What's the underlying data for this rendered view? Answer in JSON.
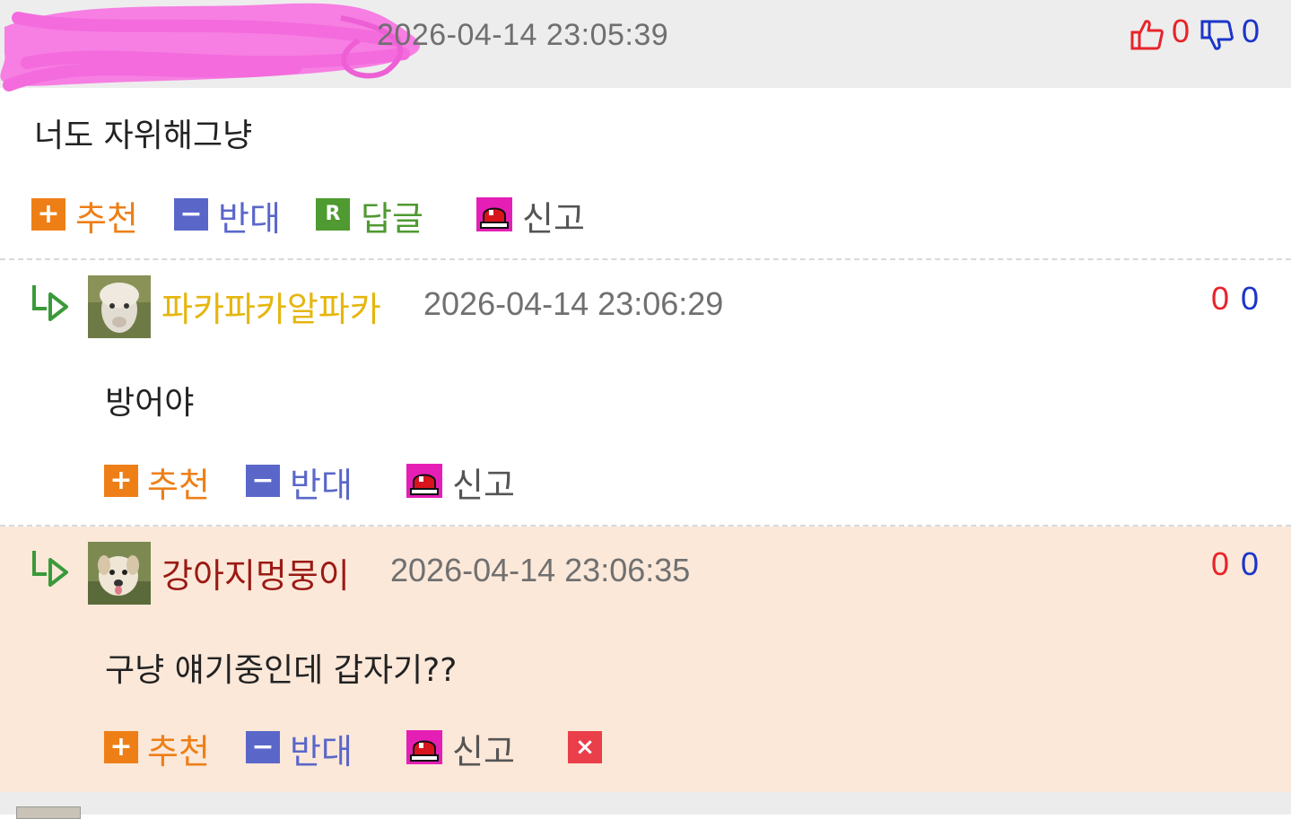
{
  "comments": [
    {
      "timestamp": "2026-04-14 23:05:39",
      "likes": "0",
      "dislikes": "0",
      "text": "너도 자위해그냥",
      "actions": {
        "recommend": "추천",
        "oppose": "반대",
        "reply": "답글",
        "report": "신고"
      }
    },
    {
      "nickname": "파카파카알파카",
      "nickname_color": "#e6b60e",
      "timestamp": "2026-04-14 23:06:29",
      "likes": "0",
      "dislikes": "0",
      "text": "방어야",
      "actions": {
        "recommend": "추천",
        "oppose": "반대",
        "report": "신고"
      }
    },
    {
      "nickname": "강아지멍뭉이",
      "nickname_color": "#9b1a14",
      "timestamp": "2026-04-14 23:06:35",
      "likes": "0",
      "dislikes": "0",
      "text": "구냥 얘기중인데 갑자기??",
      "actions": {
        "recommend": "추천",
        "oppose": "반대",
        "report": "신고"
      }
    }
  ],
  "icons": {
    "plus": "+",
    "minus": "−",
    "reply": "R",
    "delete": "×",
    "thumbs_up": "thumbs-up-icon",
    "thumbs_down": "thumbs-down-icon",
    "siren": "siren-icon",
    "reply_arrow": "reply-arrow-icon"
  }
}
